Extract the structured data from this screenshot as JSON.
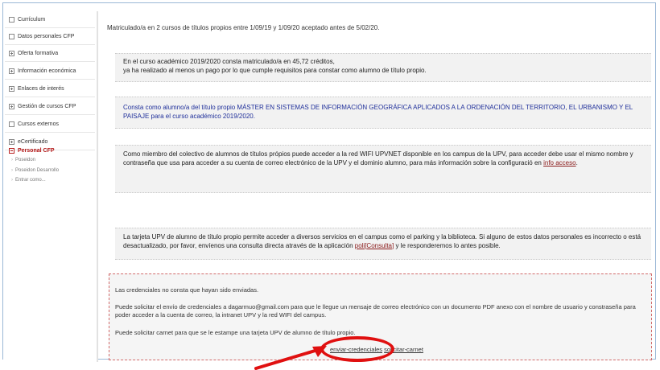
{
  "sidebar": {
    "items": [
      {
        "label": "Currículum"
      },
      {
        "label": "Datos personales CFP"
      },
      {
        "label": "Oferta formativa"
      },
      {
        "label": "Información económica"
      },
      {
        "label": "Enlaces de interés"
      },
      {
        "label": "Gestión de cursos CFP"
      },
      {
        "label": "Cursos externos"
      },
      {
        "label": "eCertificado"
      },
      {
        "label": "Personal CFP"
      }
    ],
    "subitems": [
      {
        "label": "Poseidon"
      },
      {
        "label": "Poseidon Desarrollo"
      },
      {
        "label": "Entrar como..."
      }
    ]
  },
  "main": {
    "enrolled_line": "Matriculado/a en 2 cursos de títulos propios entre 1/09/19 y 1/09/20 aceptado antes de 5/02/20.",
    "credits_box": {
      "line1": "En el curso académico 2019/2020 consta matriculado/a en 45,72 créditos,",
      "line2": "ya ha realizado al menos un pago por lo que cumple requisitos para constar como alumno de título propio."
    },
    "title_box": {
      "text": "Consta como alumno/a del título propio MÁSTER EN SISTEMAS DE INFORMACIÓN GEOGRÁFICA APLICADOS A LA ORDENACIÓN DEL TERRITORIO, EL URBANISMO Y EL PAISAJE para el curso académico 2019/2020."
    },
    "wifi_box": {
      "text": "Como miembro del colectivo de alumnos de títulos própios puede acceder a la red WIFI UPVNET disponible en los campus de la UPV, para acceder debe usar el mismo nombre y contraseña que usa para acceder a su cuenta de correo electrónico de la UPV y el dominio alumno, para más información sobre la configuració en",
      "link": "info acceso",
      "end": "."
    },
    "card_box": {
      "text": "La tarjeta UPV de alumno de título propio permite acceder a diversos servicios en el campus como el parking y la biblioteca. Si alguno de estos datos personales es incorrecto o está desactualizado, por favor, envíenos una consulta directa através de la aplicación",
      "link": "poli[Consulta]",
      "end": "y le responderemos lo antes posible."
    },
    "credentials": {
      "line1": "Las credenciales no consta que hayan sido enviadas.",
      "line2": "Puede solicitar el envío de credenciales a dagarmuo@gmail.com para que le llegue un mensaje de correo electrónico con un documento PDF anexo con el nombre de usuario y constraseña para poder acceder a la cuenta de correo, la intranet UPV y la red WIFI del campus.",
      "line3": "Puede solicitar carnet para que se le estampe una tarjeta UPV de alumno de título propio.",
      "link_enviar": "enviar-credenciales",
      "link_solicitar": "solicitar-carnet"
    }
  },
  "annotation": {
    "color": "#e01010"
  }
}
